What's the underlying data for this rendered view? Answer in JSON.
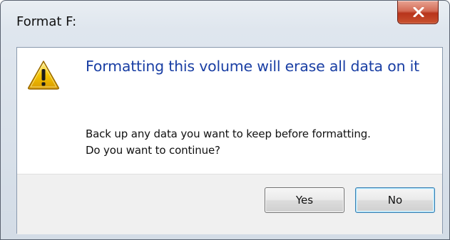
{
  "dialog": {
    "title": "Format F:",
    "close_icon": "close-icon",
    "warning_icon": "warning-icon",
    "instruction": "Formatting this volume will erase all data on it",
    "content_line1": "Back up any data you want to keep before formatting.",
    "content_line2": "Do you want to continue?",
    "buttons": {
      "yes": "Yes",
      "no": "No"
    },
    "colors": {
      "instruction_text": "#1a3fa4",
      "close_button": "#c9522f",
      "warning_yellow": "#f5c400",
      "default_button_border": "#3c7fb1"
    }
  }
}
